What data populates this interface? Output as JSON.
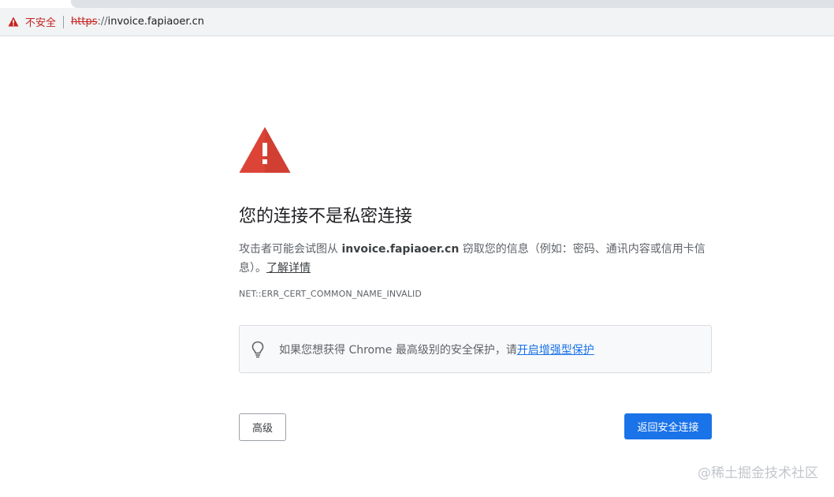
{
  "address_bar": {
    "security_label": "不安全",
    "url_scheme": "https",
    "url_separator": "://",
    "url_host": "invoice.fapiaoer.cn"
  },
  "interstitial": {
    "heading": "您的连接不是私密连接",
    "description_prefix": "攻击者可能会试图从 ",
    "description_host": "invoice.fapiaoer.cn",
    "description_suffix": " 窃取您的信息（例如：密码、通讯内容或信用卡信息）。",
    "learn_more_link": "了解详情",
    "error_code": "NET::ERR_CERT_COMMON_NAME_INVALID",
    "tip_text": "如果您想获得 Chrome 最高级别的安全保护，请",
    "tip_link": "开启增强型保护",
    "advanced_button": "高级",
    "back_button": "返回安全连接"
  },
  "watermark": "@稀土掘金技术社区",
  "icons": {
    "address_warning": "warning-triangle-icon",
    "main_warning": "warning-triangle-icon",
    "tip": "lightbulb-icon"
  },
  "colors": {
    "danger": "#c5221f",
    "warning_red": "#db4437",
    "primary_blue": "#1a73e8"
  }
}
